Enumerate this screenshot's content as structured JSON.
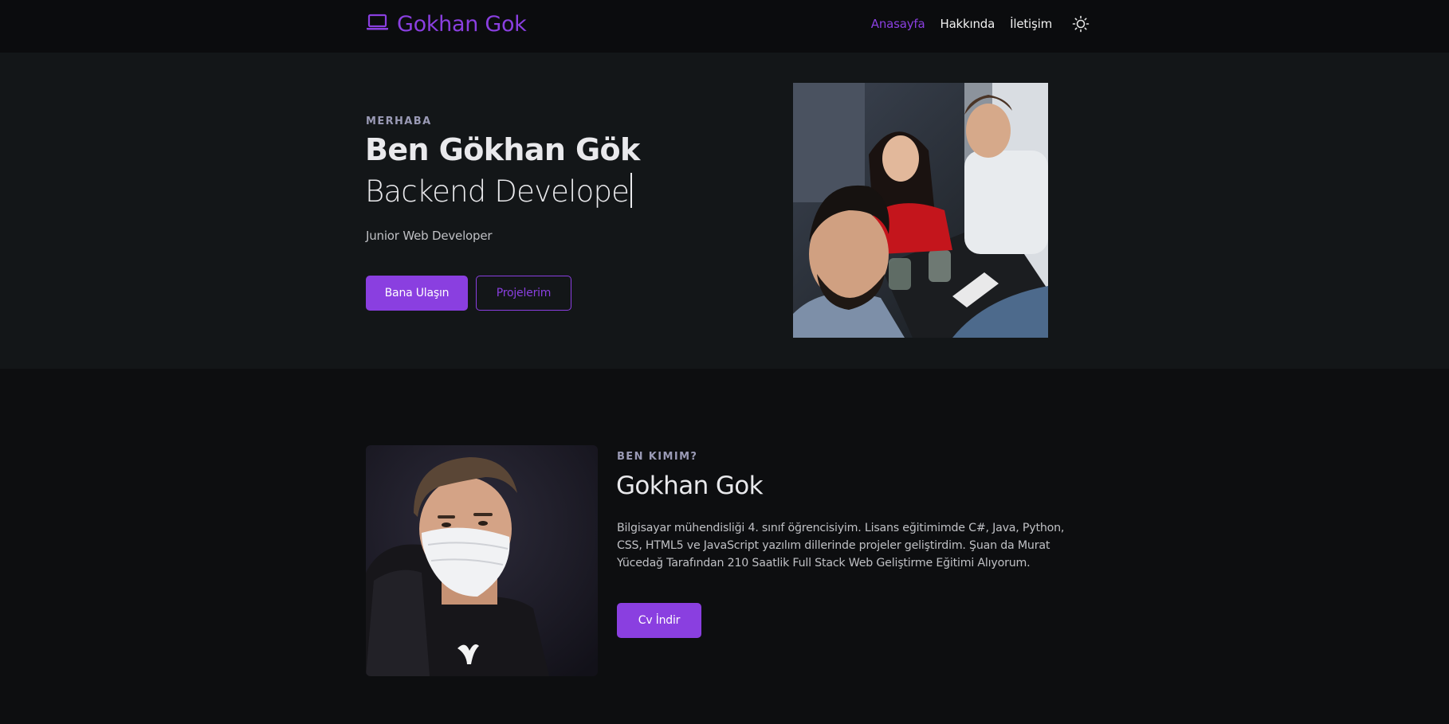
{
  "nav": {
    "brand": "Gokhan Gok",
    "brand_icon": "laptop-icon",
    "links": [
      {
        "label": "Anasayfa",
        "active": true
      },
      {
        "label": "Hakkında",
        "active": false
      },
      {
        "label": "İletişim",
        "active": false
      }
    ],
    "theme_icon": "sun-icon"
  },
  "hero": {
    "eyebrow": "MERHABA",
    "title": "Ben Gökhan Gök",
    "role": "Backend Develope",
    "subtitle": "Junior Web Developer",
    "primary_button": "Bana Ulaşın",
    "secondary_button": "Projelerim"
  },
  "about": {
    "eyebrow": "BEN KIMIM?",
    "title": "Gokhan Gok",
    "text": "Bilgisayar mühendisliği 4. sınıf öğrencisiyim. Lisans eğitimimde C#, Java, Python, CSS, HTML5 ve JavaScript yazılım dillerinde projeler geliştirdim. Şuan da Murat Yücedağ Tarafından 210 Saatlik Full Stack Web Geliştirme Eğitimi Alıyorum.",
    "button": "Cv İndir"
  },
  "colors": {
    "accent": "#8a3fe0",
    "page_bg": "#0d0e10",
    "hero_bg": "#131618",
    "navbar_bg": "#0b0c0e"
  }
}
